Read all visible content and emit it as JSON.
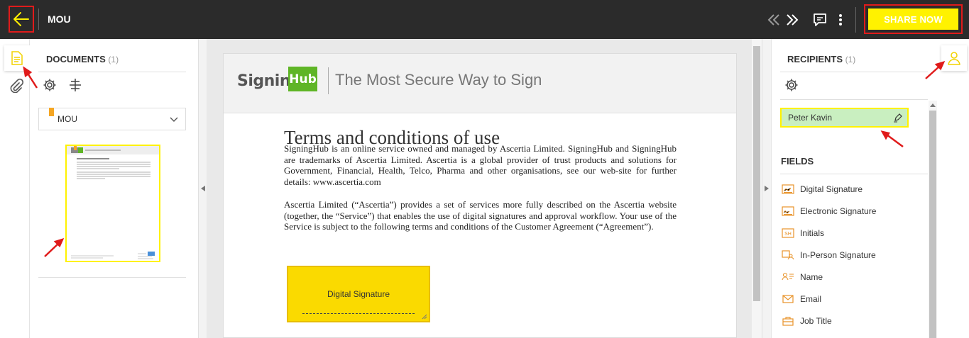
{
  "header": {
    "doc_title": "MOU",
    "share_label": "SHARE NOW",
    "icons": [
      "back-arrow-icon",
      "prev-doc-icon",
      "next-doc-icon",
      "comments-icon",
      "more-menu-icon"
    ]
  },
  "documents_panel": {
    "heading": "DOCUMENTS",
    "count": "(1)",
    "selected_document": "MOU"
  },
  "document": {
    "logo_part1": "Signing",
    "logo_part2": "Hub",
    "tagline": "The Most Secure Way to Sign",
    "title": "Terms and conditions of use",
    "paragraph1": "SigningHub is an online service owned and managed by Ascertia Limited. SigningHub and SigningHub are trademarks of Ascertia Limited. Ascertia is a global provider of trust products and solutions for Government, Financial, Health, Telco, Pharma and other organisations, see our web-site for further details: www.ascertia.com",
    "paragraph2": "Ascertia Limited (“Ascertia”) provides a set of services more fully described on the Ascertia website (together, the “Service”) that enables the use of digital signatures and approval workflow. Your use of the Service is subject to the following terms and conditions of the Customer Agreement (“Agreement”).",
    "field_label": "Digital Signature"
  },
  "recipients_panel": {
    "heading": "RECIPIENTS",
    "count": "(1)",
    "recipient_name": "Peter Kavin",
    "fields_heading": "FIELDS",
    "fields": [
      {
        "label": "Digital Signature",
        "icon": "digital-signature-icon"
      },
      {
        "label": "Electronic Signature",
        "icon": "electronic-signature-icon"
      },
      {
        "label": "Initials",
        "icon": "initials-icon"
      },
      {
        "label": "In-Person Signature",
        "icon": "in-person-signature-icon"
      },
      {
        "label": "Name",
        "icon": "name-icon"
      },
      {
        "label": "Email",
        "icon": "email-icon"
      },
      {
        "label": "Job Title",
        "icon": "job-title-icon"
      }
    ]
  },
  "colors": {
    "topbar": "#2b2b2b",
    "accent_yellow": "#fff200",
    "field_yellow": "#fada00",
    "icon_orange": "#e8932a",
    "recipient_green": "#c9efc0",
    "annotation_red": "#e01b1b"
  }
}
